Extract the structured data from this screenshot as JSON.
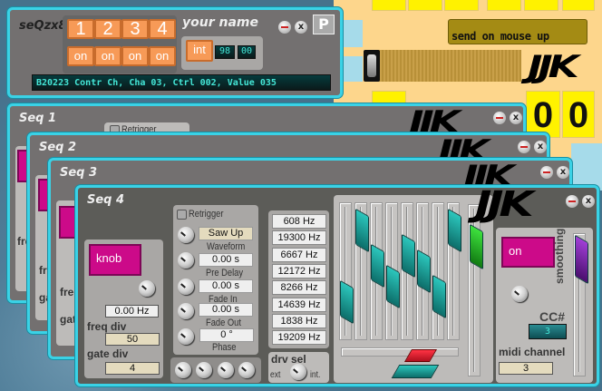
{
  "main_window": {
    "title": "seQzx8",
    "seq_buttons": [
      "1",
      "2",
      "3",
      "4"
    ],
    "on_buttons": [
      "on",
      "on",
      "on",
      "on"
    ],
    "name_label": "your name",
    "int_button": "int",
    "value_a": "98",
    "value_b": "00",
    "flag_button": "P",
    "midi_display": "B20223  Contr Ch, Cha 03, Ctrl 002, Value 035"
  },
  "background_panel": {
    "send_button": "send on mouse up",
    "logo": "JJK",
    "digits": [
      "0",
      "0"
    ]
  },
  "close_glyph": "x",
  "seq_windows": [
    {
      "title": "Seq 1"
    },
    {
      "title": "Seq 2"
    },
    {
      "title": "Seq 3"
    },
    {
      "title": "Seq 4"
    }
  ],
  "seq4": {
    "retrigger_label": "Retrigger",
    "knob_button": "knob",
    "freq_value": "0.00 Hz",
    "freq_div_label": "freq div",
    "freq_div_value": "50",
    "gate_div_label": "gate div",
    "gate_div_value": "4",
    "waveform_value": "Saw Up",
    "waveform_label": "Waveform",
    "pre_delay_value": "0.00 s",
    "pre_delay_label": "Pre Delay",
    "fade_in_value": "0.00 s",
    "fade_in_label": "Fade In",
    "fade_out_value": "0.00 s",
    "fade_out_label": "Fade Out",
    "phase_value": "0 °",
    "phase_label": "Phase",
    "frequencies": [
      "608 Hz",
      "19300 Hz",
      "6667 Hz",
      "12172 Hz",
      "8266 Hz",
      "14639 Hz",
      "1838 Hz",
      "19209 Hz"
    ],
    "drv_sel_label": "drv sel",
    "drv_ext": "ext",
    "drv_int": "int.",
    "on_button": "on",
    "smoothing_label": "smoothing",
    "cc_label": "CC#",
    "cc_value": "3",
    "midi_channel_label": "midi channel",
    "midi_channel_value": "3",
    "slider_levels": [
      0.2,
      0.9,
      0.55,
      0.35,
      0.65,
      0.5,
      0.25,
      0.9
    ],
    "accent_colors": {
      "handle": "#1fa8a0",
      "green": "#2ec82e",
      "magenta": "#cc0a89",
      "purple": "#8a2bc0",
      "red": "#e0182e"
    }
  }
}
